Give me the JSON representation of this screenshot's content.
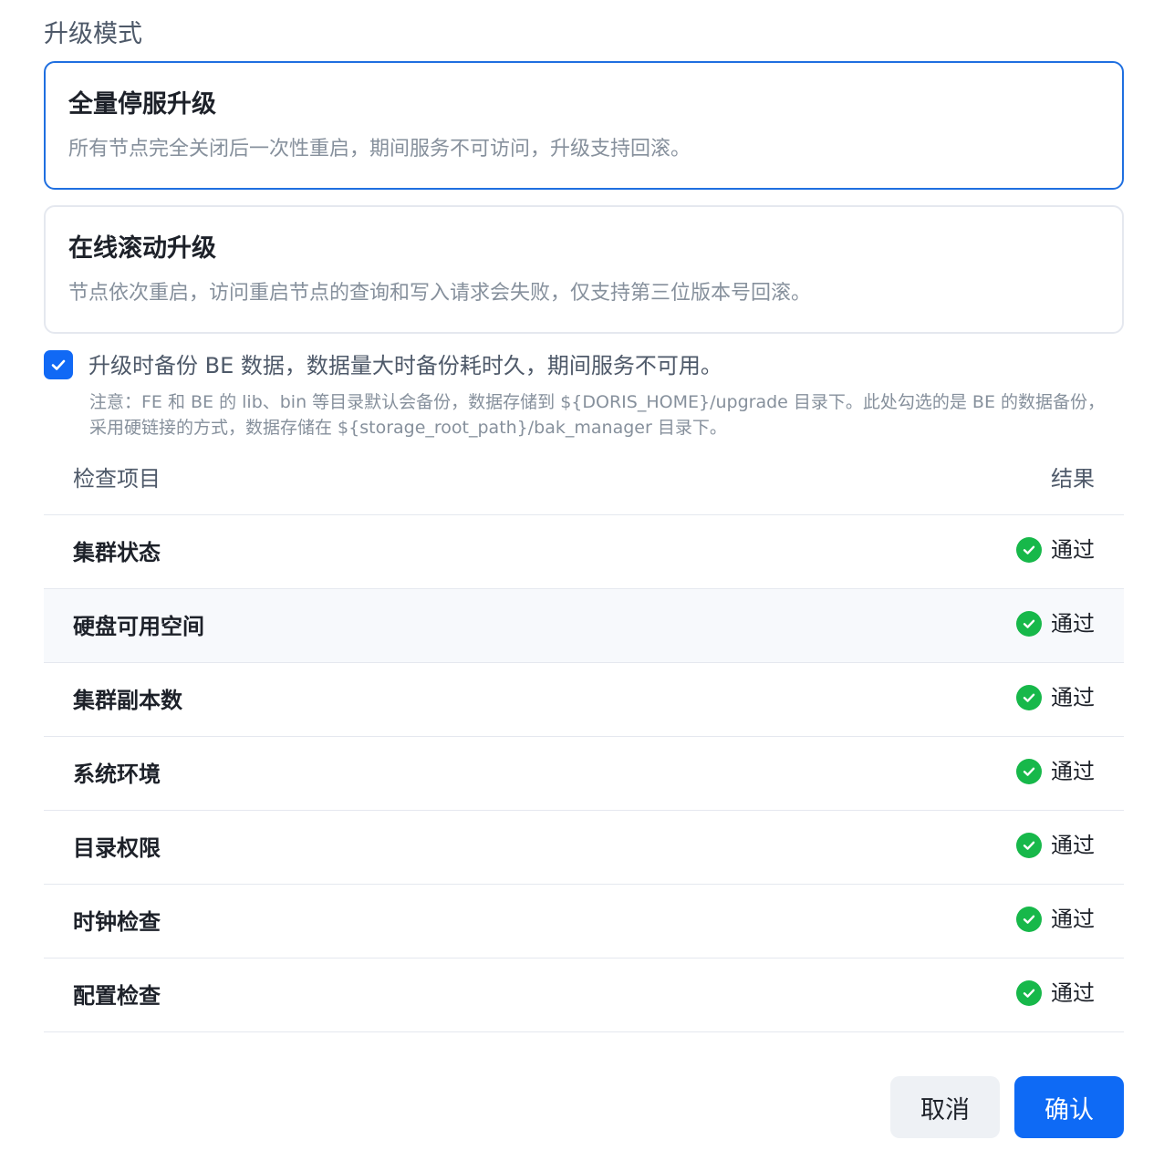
{
  "upgrade_mode": {
    "section_title": "升级模式",
    "options": [
      {
        "title": "全量停服升级",
        "description": "所有节点完全关闭后一次性重启，期间服务不可访问，升级支持回滚。",
        "selected": true
      },
      {
        "title": "在线滚动升级",
        "description": "节点依次重启，访问重启节点的查询和写入请求会失败，仅支持第三位版本号回滚。",
        "selected": false
      }
    ]
  },
  "backup": {
    "checked": true,
    "label": "升级时备份 BE 数据，数据量大时备份耗时久，期间服务不可用。",
    "note": "注意：FE 和 BE 的 lib、bin 等目录默认会备份，数据存储到 ${DORIS_HOME}/upgrade 目录下。此处勾选的是 BE 的数据备份，采用硬链接的方式，数据存储在 ${storage_root_path}/bak_manager 目录下。"
  },
  "check_table": {
    "headers": {
      "item": "检查项目",
      "result": "结果"
    },
    "rows": [
      {
        "name": "集群状态",
        "result": "通过",
        "status_icon": "check-circle-icon"
      },
      {
        "name": "硬盘可用空间",
        "result": "通过",
        "status_icon": "check-circle-icon"
      },
      {
        "name": "集群副本数",
        "result": "通过",
        "status_icon": "check-circle-icon"
      },
      {
        "name": "系统环境",
        "result": "通过",
        "status_icon": "check-circle-icon"
      },
      {
        "name": "目录权限",
        "result": "通过",
        "status_icon": "check-circle-icon"
      },
      {
        "name": "时钟检查",
        "result": "通过",
        "status_icon": "check-circle-icon"
      },
      {
        "name": "配置检查",
        "result": "通过",
        "status_icon": "check-circle-icon"
      }
    ]
  },
  "footer": {
    "cancel_label": "取消",
    "confirm_label": "确认"
  },
  "colors": {
    "primary": "#0e6af5",
    "selected_border": "#1f6fe0",
    "success": "#17b84a",
    "border": "#e5e8ef",
    "muted_text": "#86909c"
  }
}
